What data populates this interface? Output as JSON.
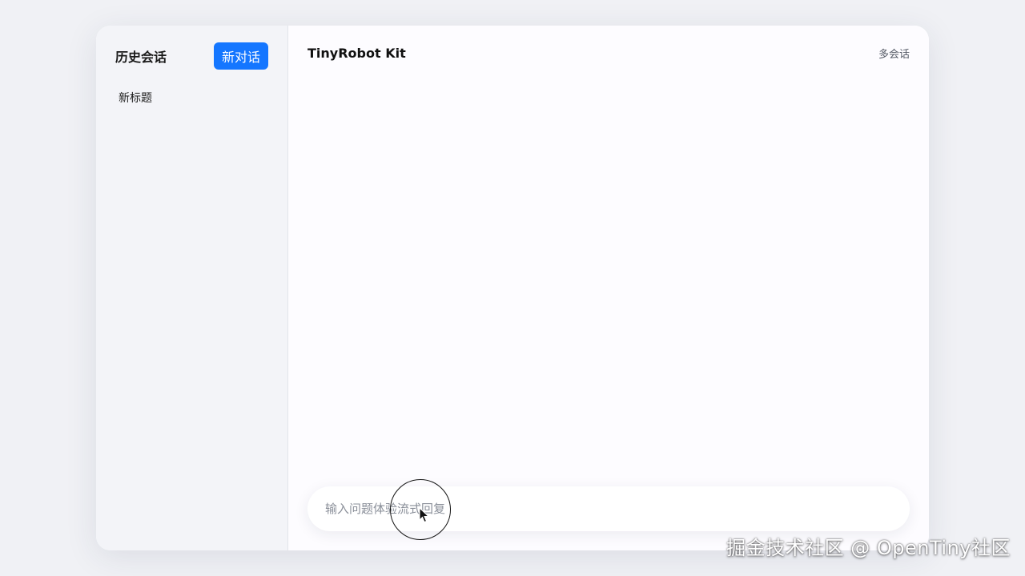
{
  "sidebar": {
    "title": "历史会话",
    "new_chat_label": "新对话",
    "conversations": [
      {
        "title": "新标题"
      }
    ]
  },
  "main": {
    "title": "TinyRobot Kit",
    "multi_session_label": "多会话"
  },
  "input": {
    "placeholder": "输入问题体验流式回复",
    "value": ""
  },
  "watermark": {
    "text": "掘金技术社区 @ OpenTiny社区"
  },
  "colors": {
    "accent": "#1476ff",
    "sidebar_bg": "#f3f4f8",
    "page_bg": "#f0f1f5"
  },
  "icons": {
    "pointer": "mouse-pointer-icon"
  }
}
